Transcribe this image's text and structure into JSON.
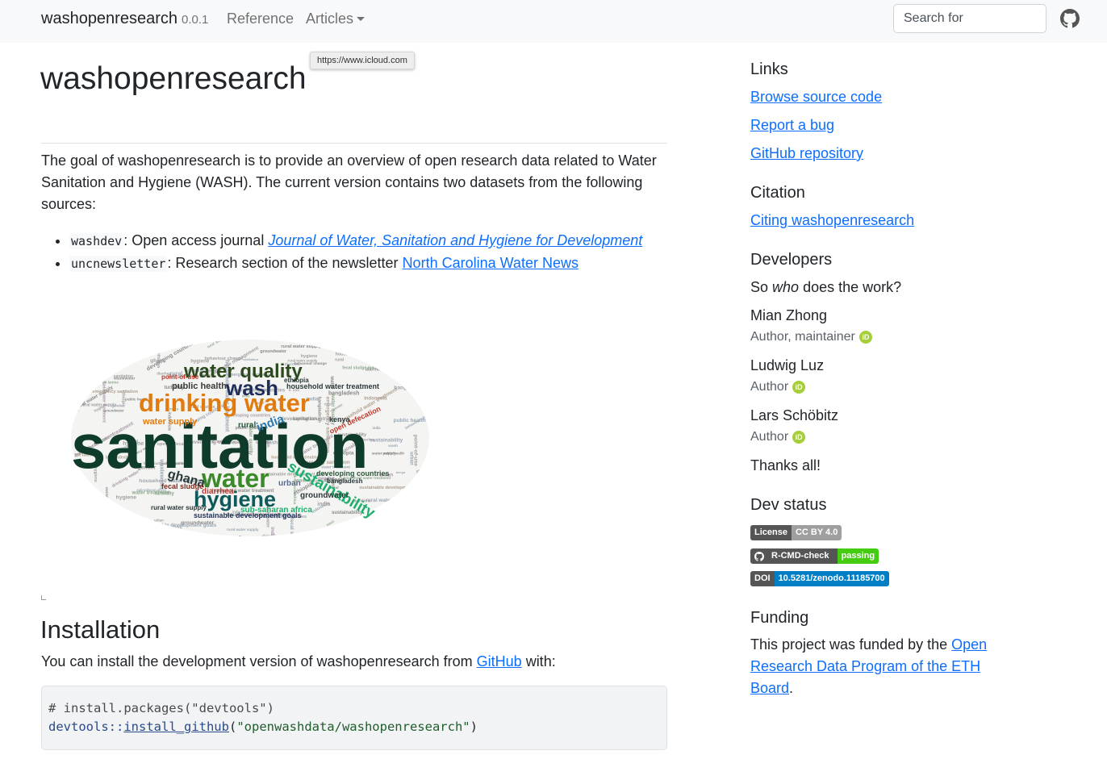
{
  "navbar": {
    "brand": "washopenresearch",
    "version": "0.0.1",
    "reference": "Reference",
    "articles": "Articles",
    "search_placeholder": "Search for",
    "github_icon": "github-icon"
  },
  "tooltip": "https://www.icloud.com",
  "main": {
    "title": "washopenresearch",
    "intro": "The goal of washopenresearch is to provide an overview of open research data related to Water Sanitation and Hygiene (WASH). The current version contains two datasets from the following sources:",
    "sources": [
      {
        "code": "washdev",
        "text": ": Open access journal ",
        "link": "Journal of Water, Sanitation and Hygiene for Development"
      },
      {
        "code": "uncnewsletter",
        "text": ": Research section of the newsletter ",
        "link": "North Carolina Water News"
      }
    ],
    "wordcloud_words": [
      "sanitation",
      "water",
      "drinking water",
      "water quality",
      "wash",
      "hygiene",
      "sustainability",
      "ghana",
      "india",
      "public health",
      "water supply",
      "groundwater",
      "sub-saharan africa",
      "sustainable development goals",
      "fecal sludge",
      "developing countries",
      "household water treatment",
      "diarrhea",
      "urban",
      "rural",
      "kenya",
      "bangladesh",
      "ethiopia",
      "open defecation",
      "rural water supply",
      "point-of-use",
      "e. coli",
      "turbidity",
      "indonesia",
      "gender",
      "wastewater",
      "water treatment",
      "fecal sludge management",
      "emergency sanitation",
      "pit latrine",
      "behaviour change"
    ],
    "installation": {
      "heading": "Installation",
      "text_before": "You can install the development version of washopenresearch from ",
      "link": "GitHub",
      "text_after": " with:",
      "code_comment": "# install.packages(\"devtools\")",
      "code_ns": "devtools::",
      "code_fn": "install_github",
      "code_open": "(",
      "code_str": "\"openwashdata/washopenresearch\"",
      "code_close": ")"
    }
  },
  "sidebar": {
    "links_heading": "Links",
    "links": [
      "Browse source code",
      "Report a bug",
      "GitHub repository"
    ],
    "citation_heading": "Citation",
    "citation_link": "Citing washopenresearch",
    "developers_heading": "Developers",
    "dev_intro_before": "So ",
    "dev_intro_em": "who",
    "dev_intro_after": " does the work?",
    "developers": [
      {
        "name": "Mian Zhong",
        "role": "Author, maintainer"
      },
      {
        "name": "Ludwig Luz",
        "role": "Author"
      },
      {
        "name": "Lars Schöbitz",
        "role": "Author"
      }
    ],
    "orcid_label": "iD",
    "thanks": "Thanks all!",
    "devstatus_heading": "Dev status",
    "badges": [
      {
        "left": "License",
        "right": "CC BY 4.0",
        "color": "#9f9f9f"
      },
      {
        "left": "R-CMD-check",
        "right": "passing",
        "color": "#4c1"
      },
      {
        "left": "DOI",
        "right": "10.5281/zenodo.11185700",
        "color": "#007ec6"
      }
    ],
    "funding_heading": "Funding",
    "funding_before": "This project was funded by the ",
    "funding_link": "Open Research Data Program of the ETH Board",
    "funding_after": "."
  }
}
